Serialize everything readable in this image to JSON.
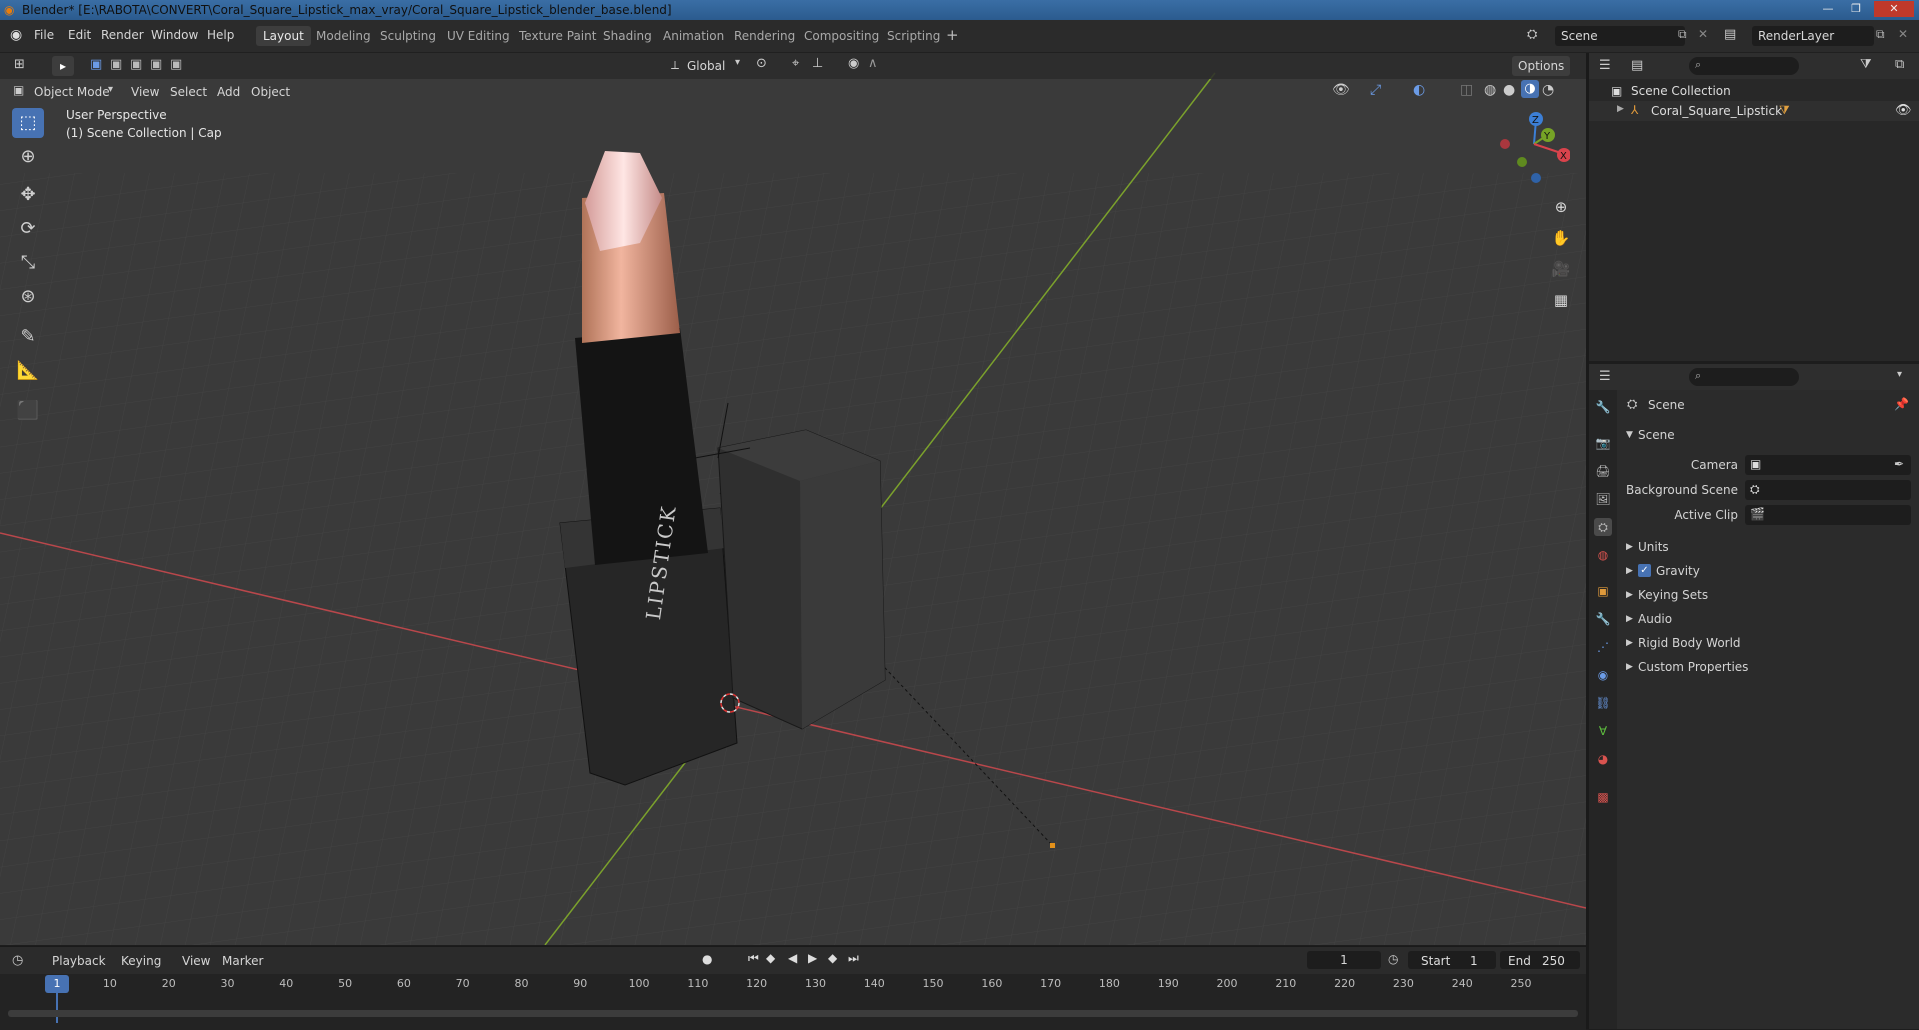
{
  "window": {
    "title": "Blender* [E:\\RABOTA\\CONVERT\\Coral_Square_Lipstick_max_vray/Coral_Square_Lipstick_blender_base.blend]",
    "minimize": "—",
    "maximize": "❐",
    "close": "✕"
  },
  "menu": [
    "File",
    "Edit",
    "Render",
    "Window",
    "Help"
  ],
  "workspaces": [
    "Layout",
    "Modeling",
    "Sculpting",
    "UV Editing",
    "Texture Paint",
    "Shading",
    "Animation",
    "Rendering",
    "Compositing",
    "Scripting"
  ],
  "active_workspace": "Layout",
  "scene_name": "Scene",
  "view_layer": "RenderLayer",
  "toolbar": {
    "transform_orientation": "Global",
    "options_label": "Options"
  },
  "viewport_header": {
    "mode": "Object Mode",
    "menus": [
      "View",
      "Select",
      "Add",
      "Object"
    ]
  },
  "viewport": {
    "perspective_label": "User Perspective",
    "collection_label": "(1) Scene Collection | Cap",
    "object_text": "LIPSTICK",
    "axes": {
      "x": "X",
      "y": "Y",
      "z": "Z"
    }
  },
  "outliner": {
    "root": "Scene Collection",
    "items": [
      "Coral_Square_Lipstick"
    ]
  },
  "properties": {
    "header": "Scene",
    "panel": "Scene",
    "rows": [
      {
        "label": "Camera"
      },
      {
        "label": "Background Scene"
      },
      {
        "label": "Active Clip"
      }
    ],
    "sections": [
      "Units",
      "Gravity",
      "Keying Sets",
      "Audio",
      "Rigid Body World",
      "Custom Properties"
    ],
    "gravity_checked": true
  },
  "timeline": {
    "menus": [
      "Playback",
      "Keying",
      "View",
      "Marker"
    ],
    "current_frame": "1",
    "start_label": "Start",
    "start": "1",
    "end_label": "End",
    "end": "250",
    "ticks": [
      "1",
      "10",
      "20",
      "30",
      "40",
      "50",
      "60",
      "70",
      "80",
      "90",
      "100",
      "110",
      "120",
      "130",
      "140",
      "150",
      "160",
      "170",
      "180",
      "190",
      "200",
      "210",
      "220",
      "230",
      "240",
      "250"
    ]
  },
  "colors": {
    "accent": "#4772b3",
    "viewport_bg": "#3a3a3a",
    "x_axis": "#c44a4a",
    "y_axis": "#7ea32b"
  }
}
